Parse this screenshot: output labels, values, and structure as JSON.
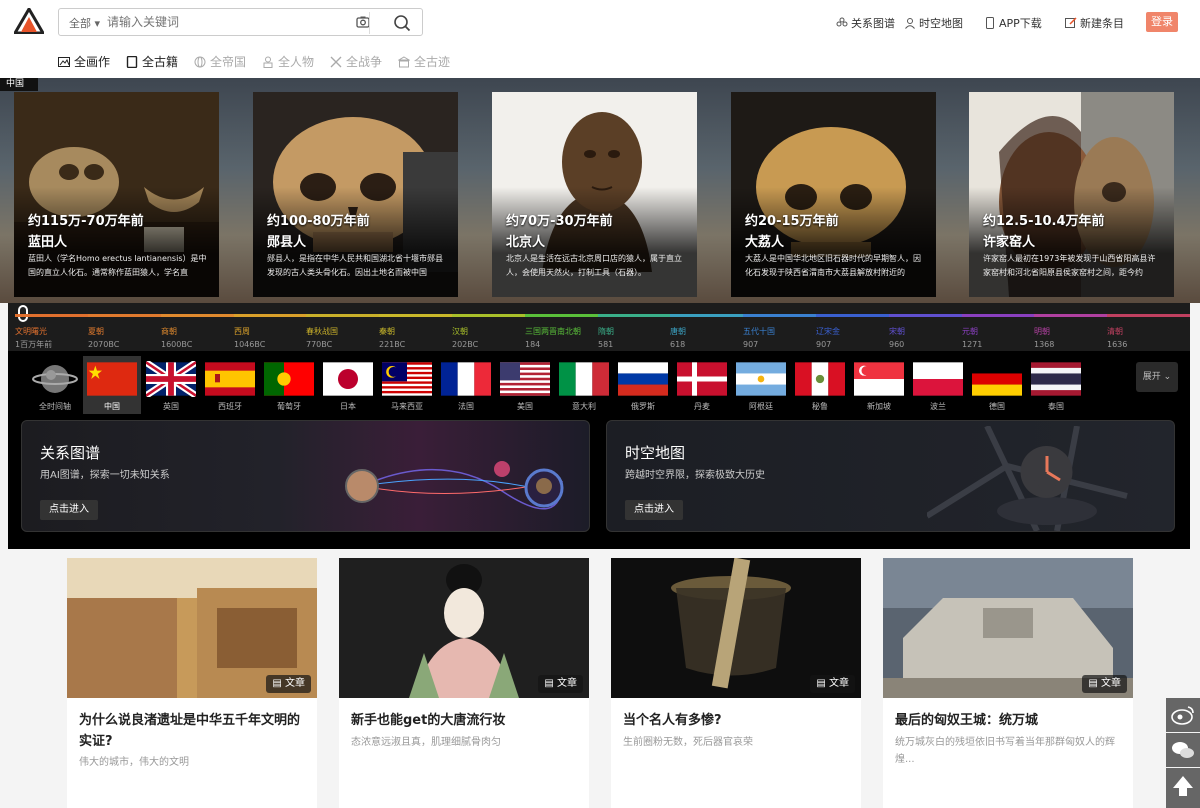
{
  "header": {
    "search_category": "全部",
    "search_placeholder": "请输入关键词",
    "topnav": [
      "关系图谱",
      "时空地图",
      "APP下载",
      "新建条目"
    ],
    "login": "登录"
  },
  "categories": [
    "全画作",
    "全古籍",
    "全帝国",
    "全人物",
    "全战争",
    "全古迹"
  ],
  "hero": {
    "tag": "中国",
    "cards": [
      {
        "period": "约115万-70万年前",
        "name": "蓝田人",
        "desc": "蓝田人（学名Homo erectus lantianensis）是中国的直立人化石。通常称作蓝田猿人，学名直"
      },
      {
        "period": "约100-80万年前",
        "name": "郧县人",
        "desc": "郧县人，是指在中华人民共和国湖北省十堰市郧县发现的古人类头骨化石。因出土地名而被中国"
      },
      {
        "period": "约70万-30万年前",
        "name": "北京人",
        "desc": "北京人是生活在远古北京周口店的猿人，属于直立人，会使用天然火，打制工具（石器）。"
      },
      {
        "period": "约20-15万年前",
        "name": "大荔人",
        "desc": "大荔人是中国华北地区旧石器时代的早期智人，因化石发现于陕西省渭南市大荔县解放村附近的"
      },
      {
        "period": "约12.5-10.4万年前",
        "name": "许家窑人",
        "desc": "许家窑人最初在1973年被发现于山西省阳高县许家窑村和河北省阳原县侯家窑村之间，距今约"
      }
    ]
  },
  "timeline": [
    {
      "label": "文明曙光",
      "year": "1百万年前",
      "color": "#e0702e"
    },
    {
      "label": "夏朝",
      "year": "2070BC",
      "color": "#e07a2e"
    },
    {
      "label": "商朝",
      "year": "1600BC",
      "color": "#e08a2e"
    },
    {
      "label": "西周",
      "year": "1046BC",
      "color": "#d9a02a"
    },
    {
      "label": "春秋战国",
      "year": "770BC",
      "color": "#c9b02a"
    },
    {
      "label": "秦朝",
      "year": "221BC",
      "color": "#c9b82a"
    },
    {
      "label": "汉朝",
      "year": "202BC",
      "color": "#a9c02a"
    },
    {
      "label": "三国两晋南北朝",
      "year": "184",
      "color": "#5ac03a"
    },
    {
      "label": "隋朝",
      "year": "581",
      "color": "#3ab08a"
    },
    {
      "label": "唐朝",
      "year": "618",
      "color": "#3aa0c0"
    },
    {
      "label": "五代十国",
      "year": "907",
      "color": "#3a80d0"
    },
    {
      "label": "辽宋金",
      "year": "907",
      "color": "#3a60d0"
    },
    {
      "label": "宋朝",
      "year": "960",
      "color": "#6050d0"
    },
    {
      "label": "元朝",
      "year": "1271",
      "color": "#8a40c0"
    },
    {
      "label": "明朝",
      "year": "1368",
      "color": "#b040a0"
    },
    {
      "label": "清朝",
      "year": "1636",
      "color": "#c04060"
    }
  ],
  "countries": [
    "全时间轴",
    "中国",
    "英国",
    "西班牙",
    "葡萄牙",
    "日本",
    "马来西亚",
    "法国",
    "美国",
    "意大利",
    "俄罗斯",
    "丹麦",
    "阿根廷",
    "秘鲁",
    "新加坡",
    "波兰",
    "德国",
    "泰国"
  ],
  "expand": "展开",
  "panels": [
    {
      "title": "关系图谱",
      "sub": "用AI图谱，探索一切未知关系",
      "btn": "点击进入"
    },
    {
      "title": "时空地图",
      "sub": "跨越时空界限，探索极致大历史",
      "btn": "点击进入"
    }
  ],
  "articles": [
    {
      "badge": "文章",
      "title": "为什么说良渚遗址是中华五千年文明的实证?",
      "desc": "伟大的城市，伟大的文明"
    },
    {
      "badge": "文章",
      "title": "新手也能get的大唐流行妆",
      "desc": "态浓意远淑且真，肌理细腻骨肉匀"
    },
    {
      "badge": "文章",
      "title": "当个名人有多惨?",
      "desc": "生前圈粉无数，死后器官哀荣"
    },
    {
      "badge": "文章",
      "title": "最后的匈奴王城：统万城",
      "desc": "统万城灰白的残垣依旧书写着当年那群匈奴人的辉煌..."
    }
  ]
}
